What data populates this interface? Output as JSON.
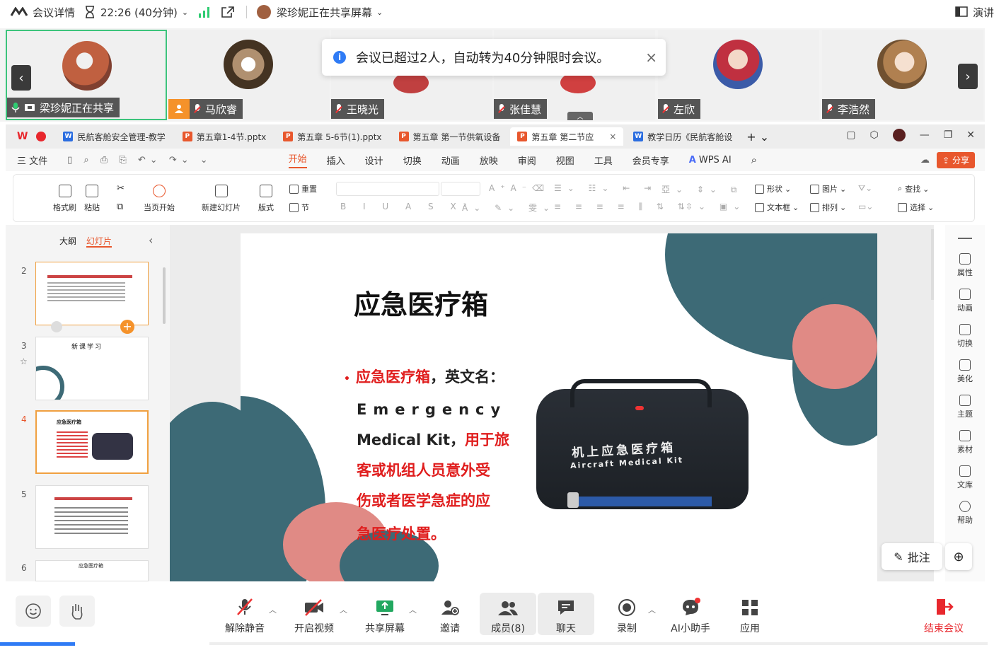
{
  "topbar": {
    "meeting_info": "会议详情",
    "time": "22:26 (40分钟)",
    "sharing": "梁珍妮正在共享屏幕",
    "right_label": "演讲"
  },
  "participants": [
    {
      "name": "梁珍妮正在共享",
      "color": "#a06040"
    },
    {
      "name": "马欣睿",
      "color": "#8a7050"
    },
    {
      "name": "王晓光",
      "color": "#c04040"
    },
    {
      "name": "张佳慧",
      "color": "#d04040"
    },
    {
      "name": "左欣",
      "color": "#d03040"
    },
    {
      "name": "李浩然",
      "color": "#b08050"
    }
  ],
  "toast": {
    "message": "会议已超过2人，自动转为40分钟限时会议。",
    "close": "×"
  },
  "wps": {
    "tabs": [
      {
        "label": "民航客舱安全管理-教学",
        "icon": "W",
        "color": "#2b6de0"
      },
      {
        "label": "第五章1-4节.pptx",
        "icon": "P",
        "color": "#e8572d"
      },
      {
        "label": "第五章 5-6节(1).pptx",
        "icon": "P",
        "color": "#e8572d"
      },
      {
        "label": "第五章 第一节供氧设备",
        "icon": "P",
        "color": "#e8572d"
      },
      {
        "label": "第五章 第二节应",
        "icon": "P",
        "color": "#e8572d"
      },
      {
        "label": "教学日历《民航客舱设",
        "icon": "W",
        "color": "#2b6de0"
      }
    ],
    "menu": [
      "开始",
      "插入",
      "设计",
      "切换",
      "动画",
      "放映",
      "审阅",
      "视图",
      "工具",
      "会员专享"
    ],
    "file_menu": "三 文件",
    "wps_ai": "WPS AI",
    "share": "分享",
    "ribbon": {
      "format_painter": "格式刷",
      "paste": "粘贴",
      "from_current": "当页开始",
      "new_slide": "新建幻灯片",
      "layout": "版式",
      "reset": "重置",
      "section": "节",
      "shape": "形状",
      "picture": "图片",
      "textbox": "文本框",
      "arrange": "排列",
      "find": "查找",
      "select": "选择"
    },
    "panel_tabs": {
      "outline": "大纲",
      "slides": "幻灯片"
    },
    "thumbnails": [
      {
        "num": "2",
        "title": ""
      },
      {
        "num": "3",
        "title": "新课学习"
      },
      {
        "num": "4",
        "title": "应急医疗箱"
      },
      {
        "num": "5",
        "title": ""
      },
      {
        "num": "6",
        "title": "应急医疗箱"
      }
    ],
    "right_tools": [
      "属性",
      "动画",
      "切换",
      "美化",
      "主题",
      "素材",
      "文库",
      "帮助"
    ],
    "annotate": "批注",
    "slide": {
      "title": "应急医疗箱",
      "bullet_red1": "应急医疗箱",
      "bullet_black1": "，英文名：",
      "line2": "Emergency",
      "line3_black": "Medical Kit，",
      "line3_red": "用于旅",
      "line4": "客或机组人员意外受",
      "line5": "伤或者医学急症的应",
      "line6": "急医疗处置。",
      "kit_cn": "机上应急医疗箱",
      "kit_en": "Aircraft Medical Kit"
    }
  },
  "bottom": {
    "unmute": "解除静音",
    "video": "开启视频",
    "share": "共享屏幕",
    "invite": "邀请",
    "members": "成员(8)",
    "chat": "聊天",
    "record": "录制",
    "ai": "AI小助手",
    "apps": "应用",
    "end": "结束会议"
  },
  "colors": {
    "accent": "#e8572d",
    "teal": "#3d6a76",
    "coral": "#e08a85",
    "green": "#2ecc71",
    "red_text": "#e01e1e"
  }
}
